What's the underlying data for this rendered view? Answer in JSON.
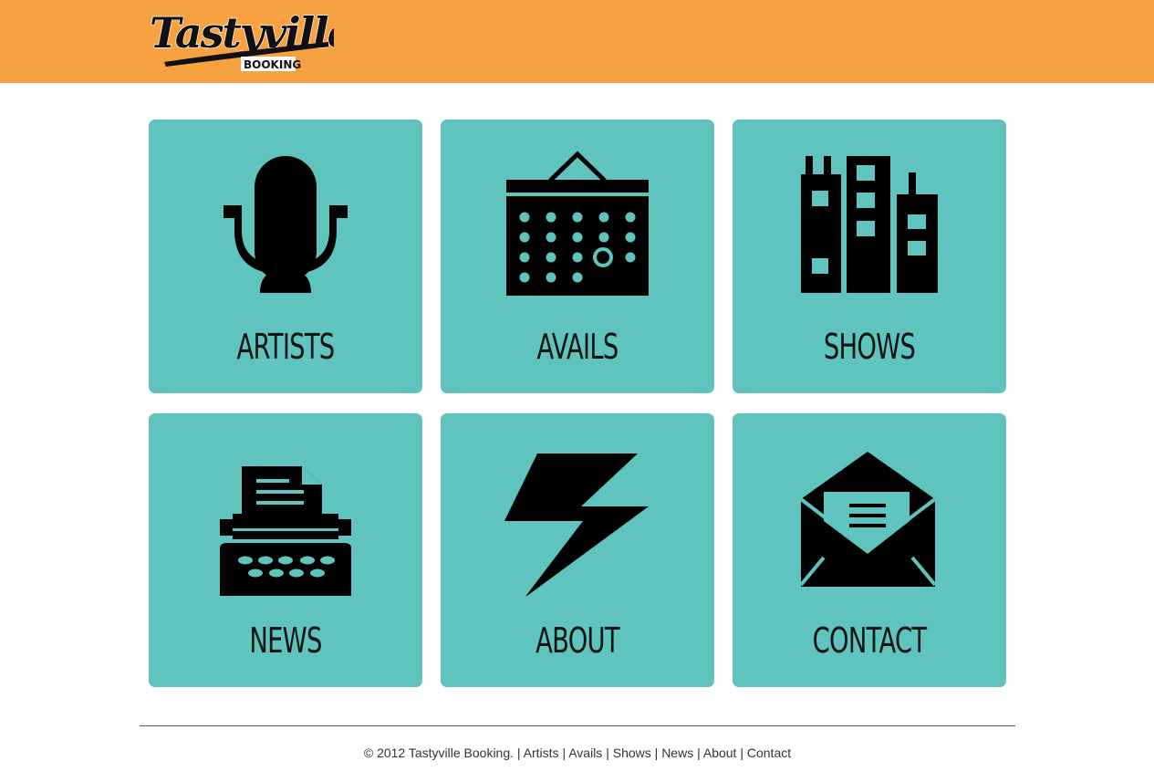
{
  "header": {
    "logo": {
      "script": "Tastyville",
      "tagline": "BOOKING"
    },
    "background": "#f7a141"
  },
  "tiles": [
    {
      "label": "ARTISTS",
      "icon": "microphone-icon"
    },
    {
      "label": "AVAILS",
      "icon": "calendar-icon"
    },
    {
      "label": "SHOWS",
      "icon": "buildings-icon"
    },
    {
      "label": "NEWS",
      "icon": "typewriter-icon"
    },
    {
      "label": "ABOUT",
      "icon": "lightning-bolt-icon"
    },
    {
      "label": "CONTACT",
      "icon": "envelope-icon"
    }
  ],
  "footer": {
    "copyright": "© 2012 Tastyville Booking.",
    "links": [
      "Artists",
      "Avails",
      "Shows",
      "News",
      "About",
      "Contact"
    ]
  },
  "colors": {
    "tile": "#5fc4be",
    "text": "#131413",
    "header": "#f7a141"
  }
}
